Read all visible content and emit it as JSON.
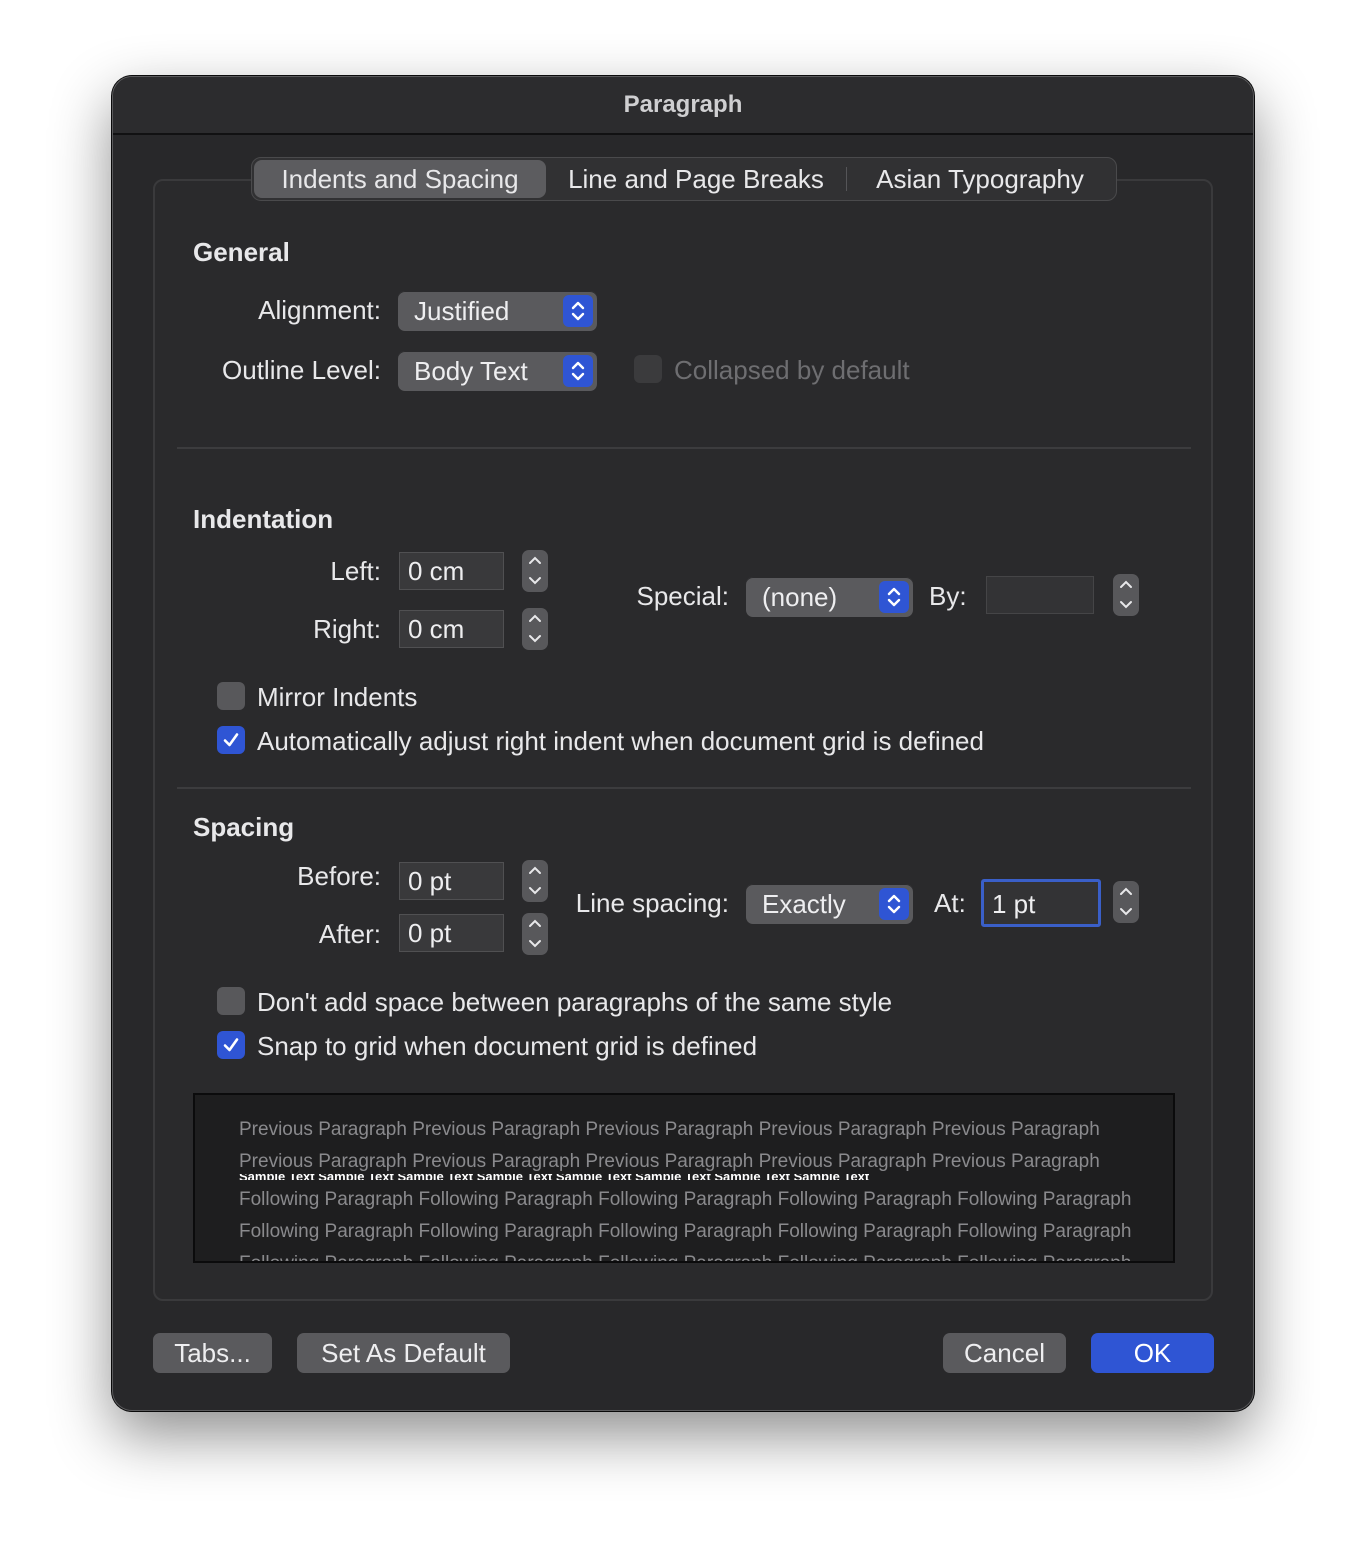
{
  "window": {
    "title": "Paragraph"
  },
  "tabs": [
    {
      "label": "Indents and Spacing",
      "active": true
    },
    {
      "label": "Line and Page Breaks",
      "active": false
    },
    {
      "label": "Asian Typography",
      "active": false
    }
  ],
  "general": {
    "heading": "General",
    "alignment_label": "Alignment:",
    "alignment_value": "Justified",
    "outline_label": "Outline Level:",
    "outline_value": "Body Text",
    "collapsed_label": "Collapsed by default",
    "collapsed_checked": false
  },
  "indentation": {
    "heading": "Indentation",
    "left_label": "Left:",
    "left_value": "0 cm",
    "right_label": "Right:",
    "right_value": "0 cm",
    "special_label": "Special:",
    "special_value": "(none)",
    "by_label": "By:",
    "by_value": "",
    "mirror_label": "Mirror Indents",
    "mirror_checked": false,
    "auto_adjust_label": "Automatically adjust right indent when document grid is defined",
    "auto_adjust_checked": true
  },
  "spacing": {
    "heading": "Spacing",
    "before_label": "Before:",
    "before_value": "0 pt",
    "after_label": "After:",
    "after_value": "0 pt",
    "line_spacing_label": "Line spacing:",
    "line_spacing_value": "Exactly",
    "at_label": "At:",
    "at_value": "1 pt",
    "no_space_label": "Don't add space between paragraphs of the same style",
    "no_space_checked": false,
    "snap_label": "Snap to grid when document grid is defined",
    "snap_checked": true
  },
  "preview": {
    "previous_lines": [
      "Previous Paragraph Previous Paragraph Previous Paragraph Previous Paragraph Previous Paragraph",
      "Previous Paragraph Previous Paragraph Previous Paragraph Previous Paragraph Previous Paragraph"
    ],
    "sample_line": "Sample Text Sample Text Sample Text Sample Text Sample Text Sample Text Sample Text Sample Text",
    "following_lines": [
      "Following Paragraph Following Paragraph Following Paragraph Following Paragraph Following Paragraph",
      "Following Paragraph Following Paragraph Following Paragraph Following Paragraph Following Paragraph",
      "Following Paragraph Following Paragraph Following Paragraph Following Paragraph Following Paragraph"
    ]
  },
  "buttons": {
    "tabs": "Tabs...",
    "set_default": "Set As Default",
    "cancel": "Cancel",
    "ok": "OK"
  },
  "colors": {
    "accent": "#2f55d4",
    "window_bg": "#28282a"
  },
  "icons": {
    "popup": "chevron-up-down-icon",
    "stepper": "stepper-arrows-icon",
    "check": "checkmark-icon"
  }
}
